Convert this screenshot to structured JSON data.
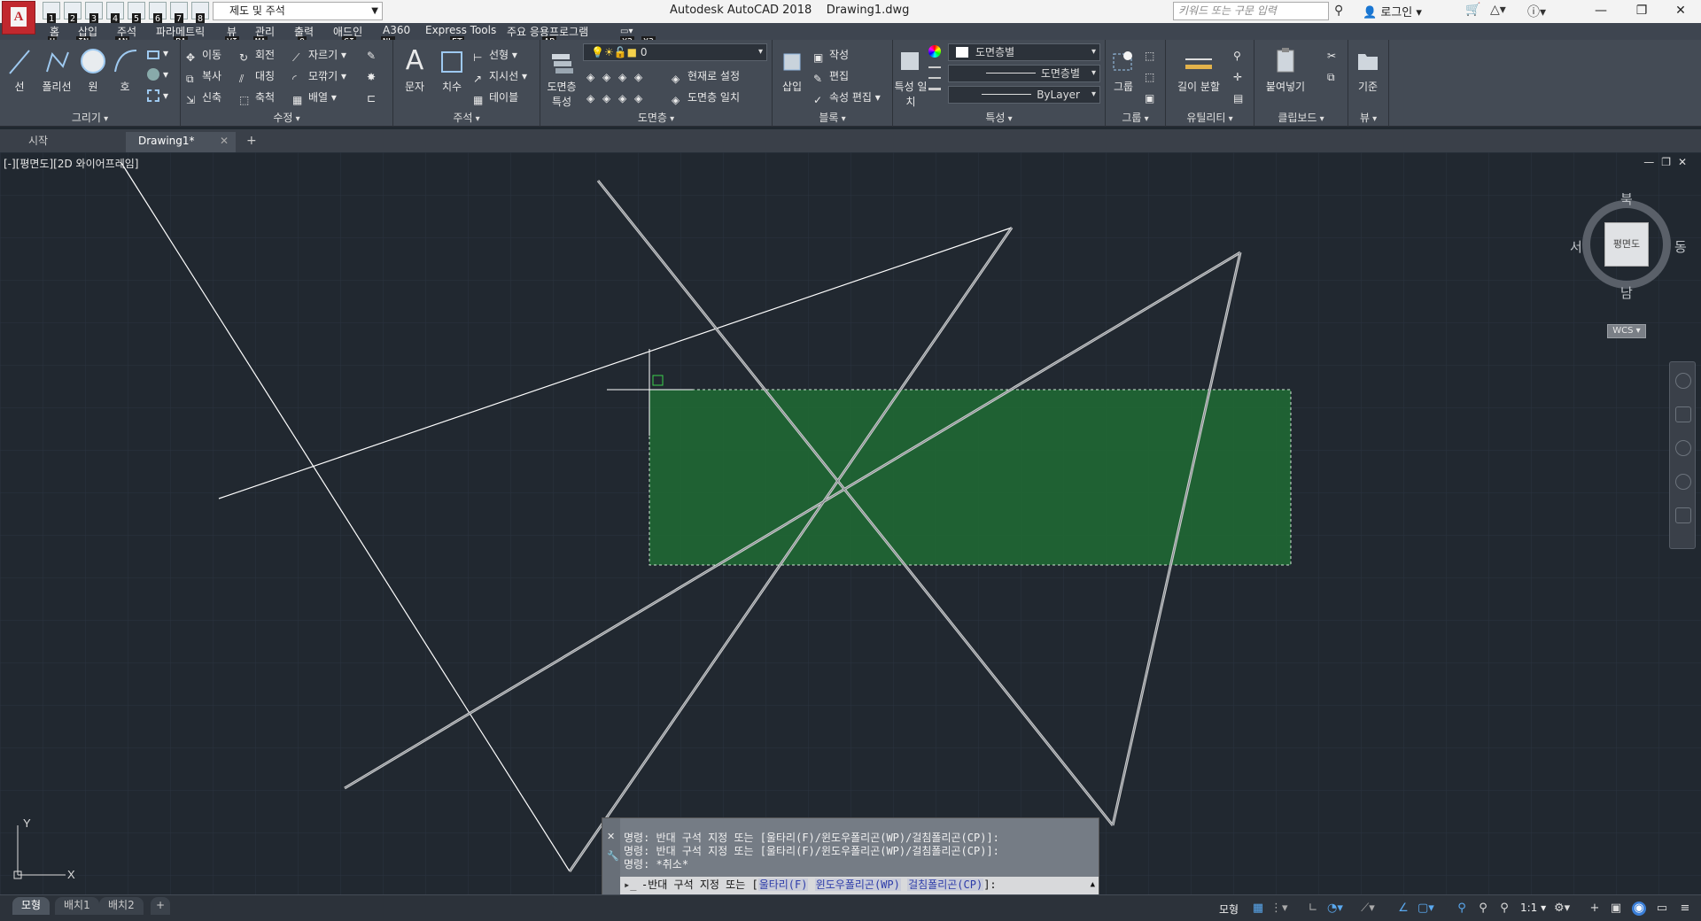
{
  "titlebar": {
    "app_name": "Autodesk AutoCAD 2018",
    "file_name": "Drawing1.dwg",
    "workspace": "제도 및 주석",
    "search_placeholder": "키워드 또는 구문 입력",
    "login": "로그인",
    "qat_keys": [
      "1",
      "2",
      "3",
      "4",
      "5",
      "6",
      "7",
      "8"
    ]
  },
  "ribbon_tabs": [
    {
      "label": "홈",
      "key": "H"
    },
    {
      "label": "삽입",
      "key": "IN"
    },
    {
      "label": "주석",
      "key": "AN"
    },
    {
      "label": "파라메트릭",
      "key": "PA"
    },
    {
      "label": "뷰",
      "key": "VI"
    },
    {
      "label": "관리",
      "key": "MA"
    },
    {
      "label": "출력",
      "key": "O"
    },
    {
      "label": "애드인",
      "key": "GI"
    },
    {
      "label": "A360",
      "key": "NL"
    },
    {
      "label": "Express Tools",
      "key": "ET"
    },
    {
      "label": "주요 응용프로그램",
      "key": "AP"
    },
    {
      "label": "",
      "key": "X2"
    },
    {
      "label": "",
      "key": "X3"
    }
  ],
  "panels": {
    "draw": {
      "title": "그리기",
      "line": "선",
      "polyline": "폴리선",
      "circle": "원",
      "arc": "호"
    },
    "modify": {
      "title": "수정",
      "move": "이동",
      "rotate": "회전",
      "trim": "자르기",
      "copy": "복사",
      "mirror": "대칭",
      "fillet": "모깎기",
      "stretch": "신축",
      "scale": "축척",
      "array": "배열"
    },
    "annotation": {
      "title": "주석",
      "text": "문자",
      "dimension": "치수",
      "linear": "선형",
      "leader": "지시선",
      "table": "테이블"
    },
    "layers": {
      "title": "도면층",
      "properties": "도면층 특성",
      "current_layer": "0",
      "make_current": "현재로 설정",
      "match": "도면층 일치"
    },
    "block": {
      "title": "블록",
      "insert": "삽입",
      "create": "작성",
      "edit": "편집",
      "attr_edit": "속성 편집"
    },
    "properties": {
      "title": "특성",
      "match": "특성 일치",
      "color": "도면층별",
      "linetype": "도면층별",
      "lineweight": "ByLayer"
    },
    "groups": {
      "title": "그룹",
      "group": "그룹"
    },
    "utilities": {
      "title": "유틸리티",
      "measure": "길이 분할"
    },
    "clipboard": {
      "title": "클립보드",
      "paste": "붙여넣기"
    },
    "view": {
      "title": "뷰",
      "base": "기준"
    }
  },
  "file_tabs": [
    {
      "label": "시작"
    },
    {
      "label": "Drawing1*"
    }
  ],
  "viewport": {
    "label": "[-][평면도][2D 와이어프레임]",
    "viewcube": {
      "north": "북",
      "south": "남",
      "east": "동",
      "west": "서",
      "face": "평면도"
    },
    "wcs": "WCS"
  },
  "command": {
    "history": [
      "명령: 반대 구석 지정 또는 [울타리(F)/윈도우폴리곤(WP)/걸침폴리곤(CP)]:",
      "명령: 반대 구석 지정 또는 [울타리(F)/윈도우폴리곤(WP)/걸침폴리곤(CP)]:",
      "명령: *취소*"
    ],
    "prompt_prefix": "반대 구석 지정 또는 [",
    "opt1": "울타리(F)",
    "opt2": "윈도우폴리곤(WP)",
    "opt3": "걸침폴리곤(CP)",
    "prompt_suffix": "]:"
  },
  "statusbar": {
    "layout_tabs": [
      "모형",
      "배치1",
      "배치2"
    ],
    "model": "모형",
    "scale": "1:1"
  },
  "colors": {
    "canvas": "#212830",
    "selection_fill": "#1f6b34",
    "ribbon": "#444b55"
  }
}
